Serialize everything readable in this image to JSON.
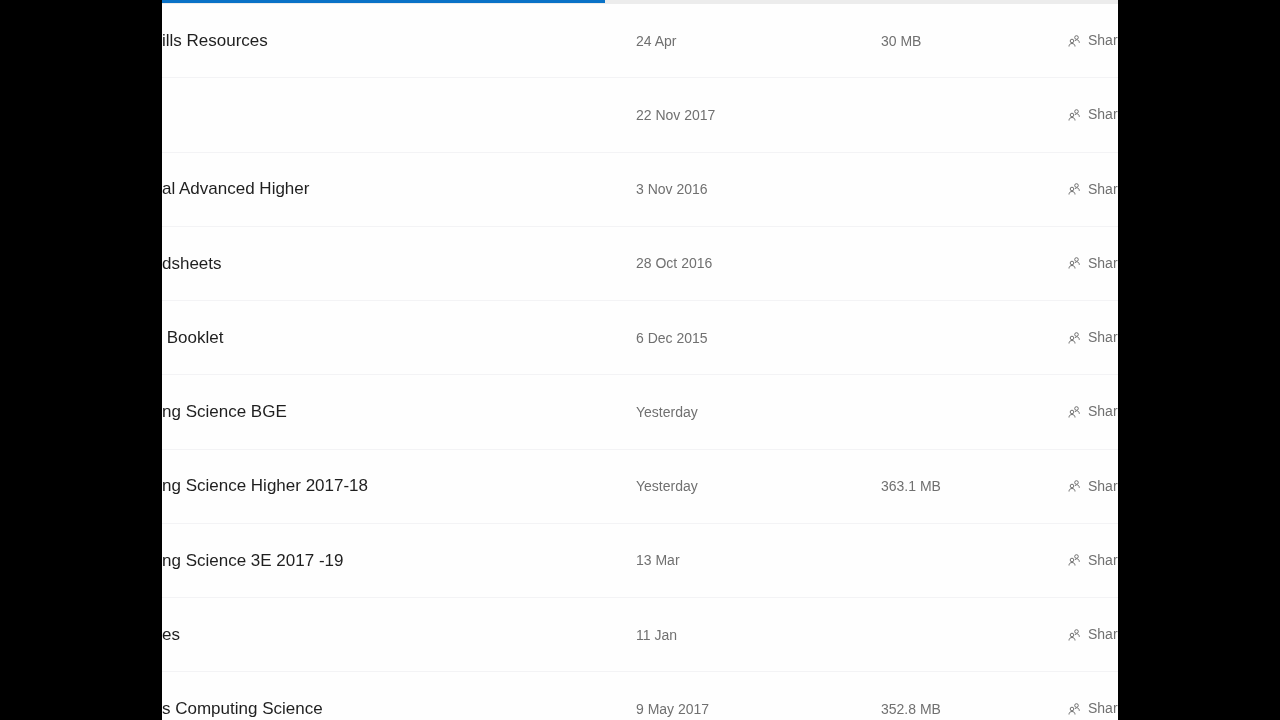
{
  "tab_indicator": {
    "level": 0.463
  },
  "rows": [
    {
      "name": "ills Resources",
      "modified": "24 Apr",
      "size": "30 MB",
      "sharing": "Shar"
    },
    {
      "modified": "22 Nov 2017",
      "sharing": "Shar"
    },
    {
      "name": "al Advanced Higher",
      "modified": "3 Nov 2016",
      "sharing": "Shar"
    },
    {
      "name": "dsheets",
      "modified": "28 Oct 2016",
      "sharing": "Shar"
    },
    {
      "name": " Booklet",
      "modified": "6 Dec 2015",
      "sharing": "Shar"
    },
    {
      "name": "ng Science BGE",
      "modified": "Yesterday",
      "sharing": "Shar"
    },
    {
      "name": "ng Science Higher 2017-18",
      "modified": "Yesterday",
      "size": "363.1 MB",
      "sharing": "Shar"
    },
    {
      "name": "ng Science 3E 2017 -19",
      "modified": "13 Mar",
      "sharing": "Shar"
    },
    {
      "name": "es",
      "modified": "11 Jan",
      "sharing": "Shar"
    },
    {
      "name": "s Computing Science",
      "modified": "9 May 2017",
      "size": "352.8 MB",
      "sharing": "Shar"
    }
  ]
}
